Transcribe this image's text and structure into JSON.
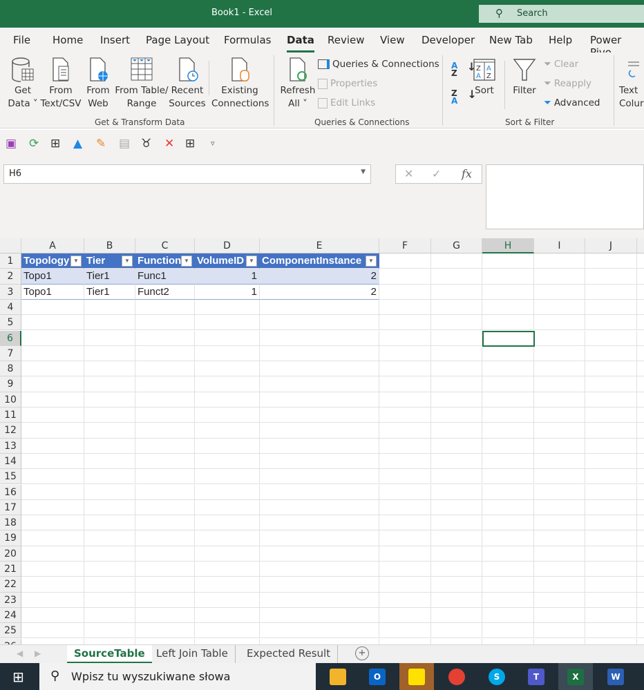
{
  "window": {
    "title": "Book1  -  Excel",
    "search": "Search"
  },
  "menu": [
    "File",
    "Home",
    "Insert",
    "Page Layout",
    "Formulas",
    "Data",
    "Review",
    "View",
    "Developer",
    "New Tab",
    "Help",
    "Power Pivo"
  ],
  "active_menu": "Data",
  "ribbon": {
    "get_data": [
      "Get",
      "Data ˅"
    ],
    "from_text": [
      "From",
      "Text/CSV"
    ],
    "from_web": [
      "From",
      "Web"
    ],
    "from_table": [
      "From Table/",
      "Range"
    ],
    "recent": [
      "Recent",
      "Sources"
    ],
    "existing": [
      "Existing",
      "Connections"
    ],
    "group1": "Get & Transform Data",
    "refresh": [
      "Refresh",
      "All ˅"
    ],
    "queries": "Queries & Connections",
    "properties": "Properties",
    "edit_links": "Edit Links",
    "group2": "Queries & Connections",
    "sort": "Sort",
    "filter": "Filter",
    "clear": "Clear",
    "reapply": "Reapply",
    "advanced": "Advanced",
    "group3": "Sort & Filter",
    "text_cols": [
      "Text",
      "Colur"
    ]
  },
  "formula_bar": {
    "name_box": "H6",
    "formula": ""
  },
  "columns": [
    "A",
    "B",
    "C",
    "D",
    "E",
    "F",
    "G",
    "H",
    "I",
    "J"
  ],
  "table": {
    "headers": [
      "Topology",
      "Tier",
      "Function",
      "VolumeID",
      "ComponentInstance"
    ],
    "rows": [
      [
        "Topo1",
        "Tier1",
        "Func1",
        "1",
        "2"
      ],
      [
        "Topo1",
        "Tier1",
        "Funct2",
        "1",
        "2"
      ]
    ]
  },
  "selected_cell": "H6",
  "sheets": [
    "SourceTable",
    "Left Join Table",
    "Expected Result"
  ],
  "active_sheet": "SourceTable",
  "taskbar": {
    "search_placeholder": "Wpisz tu wyszukiwane słowa"
  },
  "colors": {
    "excel_green": "#217346",
    "table_header": "#4472c4",
    "table_band": "#d9e1f2"
  }
}
